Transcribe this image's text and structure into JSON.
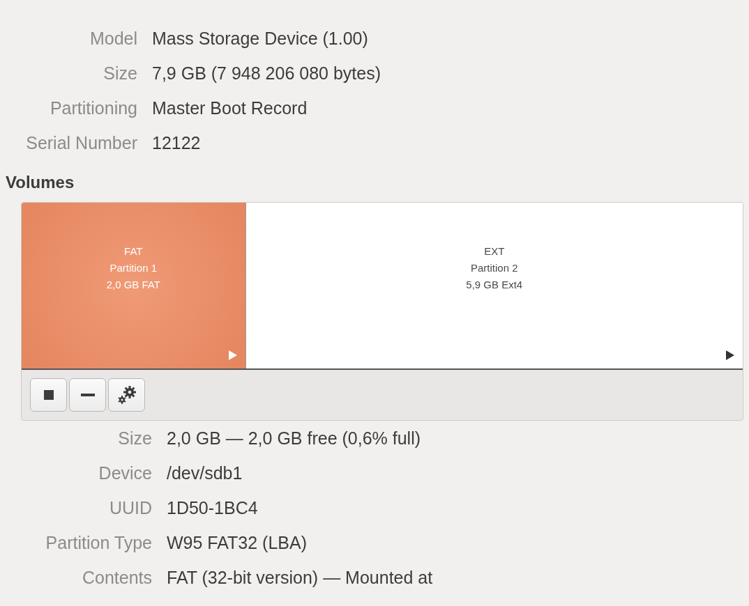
{
  "device_info": [
    {
      "label": "Model",
      "value": "Mass Storage Device (1.00)"
    },
    {
      "label": "Size",
      "value": "7,9 GB (7 948 206 080 bytes)"
    },
    {
      "label": "Partitioning",
      "value": "Master Boot Record"
    },
    {
      "label": "Serial Number",
      "value": "12122"
    }
  ],
  "volumes": {
    "heading": "Volumes",
    "partitions": [
      {
        "fs": "FAT",
        "name": "Partition 1",
        "summary": "2,0 GB FAT",
        "level": 0.31,
        "selected": true
      },
      {
        "fs": "EXT",
        "name": "Partition 2",
        "summary": "5,9 GB Ext4",
        "level": 0.69,
        "selected": false
      }
    ],
    "toolbar": [
      {
        "kind": "stop"
      },
      {
        "kind": "remove"
      },
      {
        "kind": "settings"
      }
    ]
  },
  "volume_info": [
    {
      "label": "Size",
      "value": "2,0 GB — 2,0 GB free (0,6% full)"
    },
    {
      "label": "Device",
      "value": "/dev/sdb1"
    },
    {
      "label": "UUID",
      "value": "1D50-1BC4"
    },
    {
      "label": "Partition Type",
      "value": "W95 FAT32 (LBA)"
    },
    {
      "label": "Contents",
      "value": "FAT (32-bit version) — Mounted at"
    }
  ]
}
